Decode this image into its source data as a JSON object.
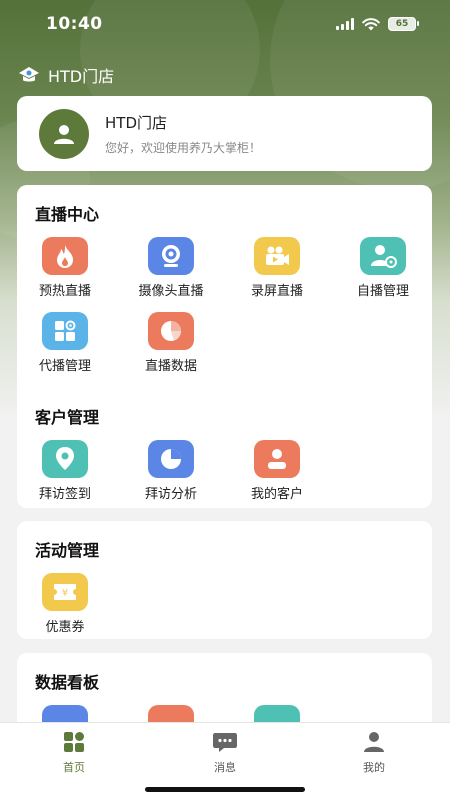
{
  "status_bar": {
    "time": "10:40",
    "battery": "65"
  },
  "store_header": {
    "name": "HTD门店"
  },
  "profile": {
    "name": "HTD门店",
    "greeting": "您好，欢迎使用养乃大掌柜！"
  },
  "sections": {
    "live": {
      "title": "直播中心",
      "items": [
        {
          "label": "预热直播",
          "icon": "flame-icon",
          "color": "#ec7a5c"
        },
        {
          "label": "摄像头直播",
          "icon": "webcam-icon",
          "color": "#5b86e5"
        },
        {
          "label": "录屏直播",
          "icon": "video-camera-icon",
          "color": "#f2c94c"
        },
        {
          "label": "自播管理",
          "icon": "user-settings-icon",
          "color": "#4fc1b4"
        },
        {
          "label": "代播管理",
          "icon": "grid-settings-icon",
          "color": "#5ab4e8"
        },
        {
          "label": "直播数据",
          "icon": "pie-chart-icon",
          "color": "#ec7a5c"
        }
      ]
    },
    "customer": {
      "title": "客户管理",
      "items": [
        {
          "label": "拜访签到",
          "icon": "location-pin-icon",
          "color": "#4fc1b4"
        },
        {
          "label": "拜访分析",
          "icon": "pie-analysis-icon",
          "color": "#5b86e5"
        },
        {
          "label": "我的客户",
          "icon": "customer-icon",
          "color": "#ec7a5c"
        }
      ]
    },
    "activity": {
      "title": "活动管理",
      "items": [
        {
          "label": "优惠券",
          "icon": "coupon-icon",
          "color": "#f2c94c"
        }
      ]
    },
    "dashboard": {
      "title": "数据看板"
    }
  },
  "tabbar": {
    "home": "首页",
    "messages": "消息",
    "mine": "我的",
    "active_color": "#5d7a3b",
    "inactive_color": "#555555"
  },
  "colors": {
    "brand_green": "#5d7a3b",
    "background": "#f2f2f2"
  }
}
